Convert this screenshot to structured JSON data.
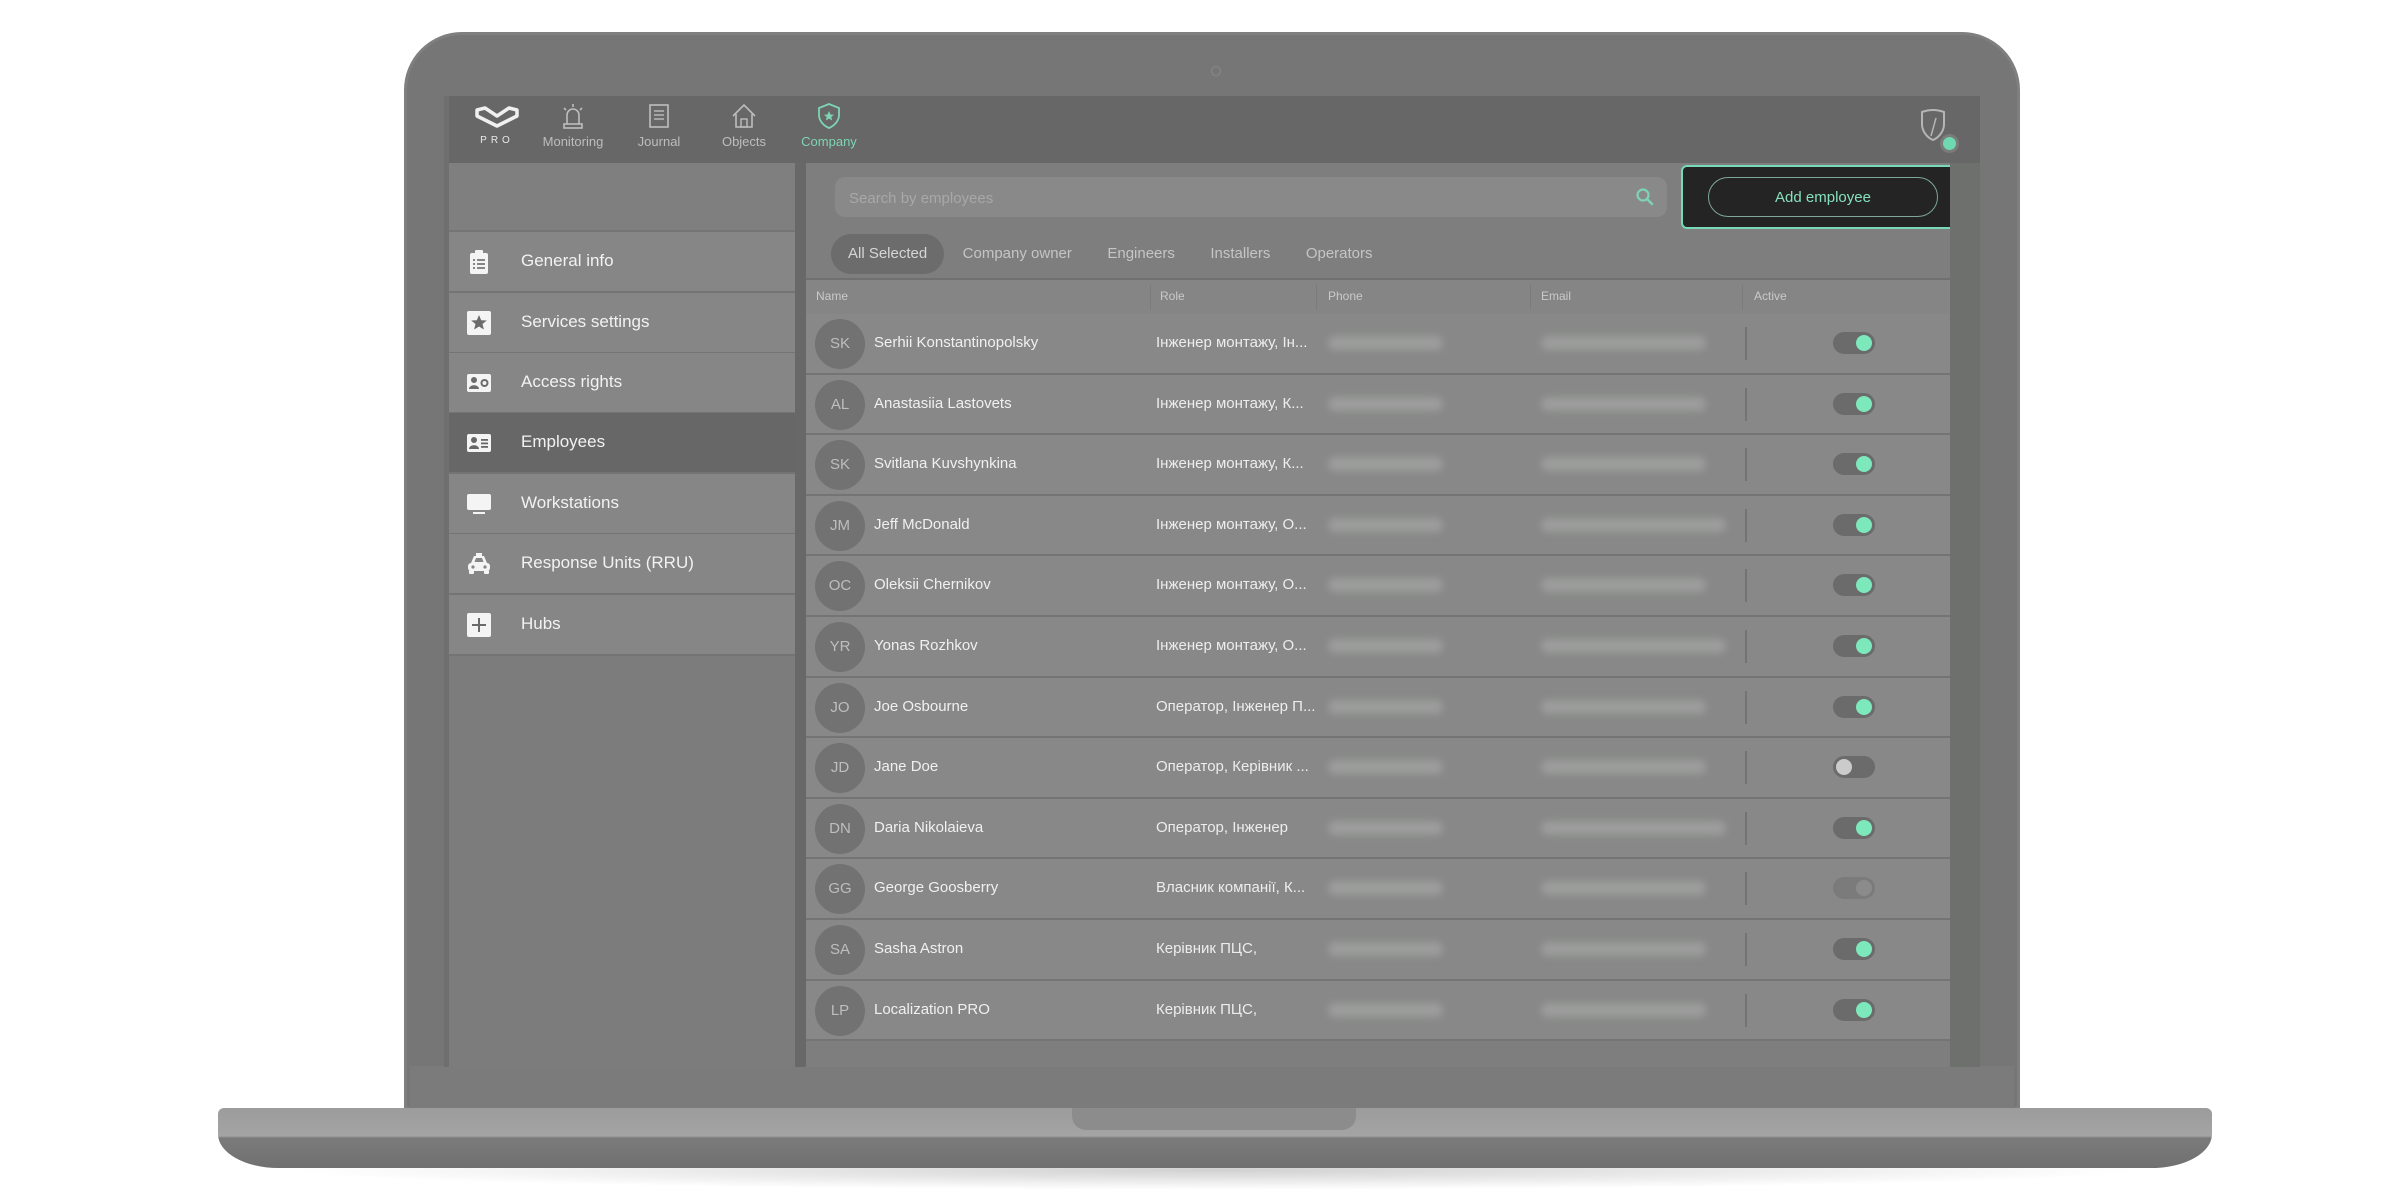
{
  "topnav": {
    "logo_text": "PRO",
    "items": [
      {
        "label": "Monitoring",
        "icon": "siren-icon",
        "active": false
      },
      {
        "label": "Journal",
        "icon": "document-icon",
        "active": false
      },
      {
        "label": "Objects",
        "icon": "house-icon",
        "active": false
      },
      {
        "label": "Company",
        "icon": "shield-star-icon",
        "active": true
      }
    ],
    "account_icon": "shield-account-icon"
  },
  "sidebar": {
    "items": [
      {
        "label": "General info",
        "icon": "clipboard-list-icon",
        "selected": false
      },
      {
        "label": "Services settings",
        "icon": "star-icon",
        "selected": false
      },
      {
        "label": "Access rights",
        "icon": "user-gear-card-icon",
        "selected": false
      },
      {
        "label": "Employees",
        "icon": "id-card-icon",
        "selected": true
      },
      {
        "label": "Workstations",
        "icon": "monitor-icon",
        "selected": false
      },
      {
        "label": "Response Units (RRU)",
        "icon": "car-icon",
        "selected": false
      },
      {
        "label": "Hubs",
        "icon": "plus-box-icon",
        "selected": false
      }
    ]
  },
  "search": {
    "placeholder": "Search by employees",
    "value": ""
  },
  "add_employee_label": "Add employee",
  "filters": [
    {
      "label": "All Selected",
      "active": true
    },
    {
      "label": "Company owner",
      "active": false
    },
    {
      "label": "Engineers",
      "active": false
    },
    {
      "label": "Installers",
      "active": false
    },
    {
      "label": "Operators",
      "active": false
    }
  ],
  "table": {
    "columns": [
      "Name",
      "Role",
      "Phone",
      "Email",
      "Active"
    ],
    "rows": [
      {
        "initials": "SK",
        "name": "Serhii Konstantinopolsky",
        "role": "Інженер монтажу, Ін...",
        "active": "on"
      },
      {
        "initials": "AL",
        "name": "Anastasiia Lastovets",
        "role": "Інженер монтажу, К...",
        "active": "on"
      },
      {
        "initials": "SK",
        "name": "Svitlana Kuvshynkina",
        "role": "Інженер монтажу, К...",
        "active": "on"
      },
      {
        "initials": "JM",
        "name": "Jeff McDonald",
        "role": "Інженер монтажу, О...",
        "active": "on"
      },
      {
        "initials": "OC",
        "name": "Oleksii Chernikov",
        "role": "Інженер монтажу, О...",
        "active": "on"
      },
      {
        "initials": "YR",
        "name": "Yonas Rozhkov",
        "role": "Інженер монтажу, О...",
        "active": "on"
      },
      {
        "initials": "JO",
        "name": "Joe Osbourne",
        "role": "Оператор, Інженер П...",
        "active": "on"
      },
      {
        "initials": "JD",
        "name": "Jane Doe",
        "role": "Оператор, Керівник ...",
        "active": "off"
      },
      {
        "initials": "DN",
        "name": "Daria Nikolaieva",
        "role": "Оператор, Інженер",
        "active": "on"
      },
      {
        "initials": "GG",
        "name": "George Goosberry",
        "role": "Власник компанії, К...",
        "active": "disabled"
      },
      {
        "initials": "SA",
        "name": "Sasha Astron",
        "role": "Керівник ПЦС,",
        "active": "on"
      },
      {
        "initials": "LP",
        "name": "Localization PRO",
        "role": "Керівник ПЦС,",
        "active": "on"
      }
    ]
  },
  "colors": {
    "accent": "#7fd3b4",
    "toggle_on": "#7ee8bd",
    "add_button_bg": "#242424"
  }
}
